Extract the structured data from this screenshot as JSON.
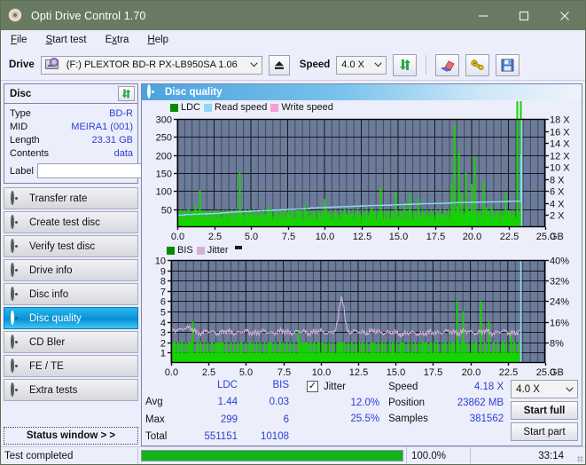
{
  "window": {
    "title": "Opti Drive Control 1.70",
    "app_icon": "disc-icon",
    "minimize": "–",
    "maximize": "□",
    "close": "✕"
  },
  "menu": {
    "items": [
      {
        "label": "File",
        "accel": "F"
      },
      {
        "label": "Start test",
        "accel": "S"
      },
      {
        "label": "Extra",
        "accel": "x"
      },
      {
        "label": "Help",
        "accel": "H"
      }
    ]
  },
  "toolbar": {
    "drive_label": "Drive",
    "drive_value": "(F:)  PLEXTOR BD-R  PX-LB950SA 1.06",
    "drive_icon": "drive-icon",
    "eject_icon": "eject-icon",
    "speed_label": "Speed",
    "speed_value": "4.0 X",
    "refresh_icon": "refresh-icon",
    "erase_icon": "eraser-icon",
    "tools_icon": "tools-icon",
    "save_icon": "save-icon"
  },
  "sidebar": {
    "disc_panel": {
      "title": "Disc",
      "refresh_icon": "refresh-icon",
      "rows": [
        {
          "key": "Type",
          "value": "BD-R"
        },
        {
          "key": "MID",
          "value": "MEIRA1 (001)"
        },
        {
          "key": "Length",
          "value": "23.31 GB"
        },
        {
          "key": "Contents",
          "value": "data"
        }
      ],
      "label_key": "Label",
      "label_value": "",
      "label_placeholder": "",
      "label_button_icon": "disc-icon"
    },
    "nav": [
      {
        "label": "Transfer rate",
        "icon": "disc-icon",
        "active": false
      },
      {
        "label": "Create test disc",
        "icon": "disc-icon",
        "active": false
      },
      {
        "label": "Verify test disc",
        "icon": "disc-icon",
        "active": false
      },
      {
        "label": "Drive info",
        "icon": "disc-icon",
        "active": false
      },
      {
        "label": "Disc info",
        "icon": "disc-icon",
        "active": false
      },
      {
        "label": "Disc quality",
        "icon": "disc-icon",
        "active": true
      },
      {
        "label": "CD Bler",
        "icon": "disc-icon",
        "active": false
      },
      {
        "label": "FE / TE",
        "icon": "disc-icon",
        "active": false
      },
      {
        "label": "Extra tests",
        "icon": "disc-icon",
        "active": false
      }
    ],
    "status_window_button": "Status window > >"
  },
  "main": {
    "header_title": "Disc quality",
    "header_icon": "disc-icon"
  },
  "stats": {
    "columns": [
      "LDC",
      "BIS"
    ],
    "rows": [
      {
        "key": "Avg",
        "ldc": "1.44",
        "bis": "0.03"
      },
      {
        "key": "Max",
        "ldc": "299",
        "bis": "6"
      },
      {
        "key": "Total",
        "ldc": "551151",
        "bis": "10108"
      }
    ],
    "jitter": {
      "label": "Jitter",
      "checked": true,
      "check_glyph": "✓",
      "avg": "12.0%",
      "max": "25.5%"
    },
    "speed": {
      "key": "Speed",
      "value": "4.18 X"
    },
    "position": {
      "key": "Position",
      "value": "23862 MB"
    },
    "samples": {
      "key": "Samples",
      "value": "381562"
    },
    "speed_select": "4.0 X",
    "start_full": "Start full",
    "start_part": "Start part"
  },
  "statusbar": {
    "message": "Test completed",
    "percent_label": "100.0%",
    "progress": 100,
    "time": "33:14"
  },
  "colors": {
    "titlebar": "#687a61",
    "plot_bg": "#6b7b99",
    "ldc_green": "#15d400",
    "bis_green": "#15d400",
    "read_speed": "#8fd8f5",
    "write_speed": "#f49fd8",
    "jitter_pink": "#d8aed8",
    "accent_blue": "#2b3fd0",
    "progress_green": "#13b31a",
    "active_nav": "#0a8fd4"
  },
  "chart_data": [
    {
      "type": "line",
      "id": "ldc-chart",
      "title": "",
      "legend": [
        {
          "name": "LDC",
          "color": "#0a8a00",
          "swatch": "#0a8a00"
        },
        {
          "name": "Read speed",
          "color": "#8fd8f5",
          "swatch": "#8fd8f5"
        },
        {
          "name": "Write speed",
          "color": "#f49fd8",
          "swatch": "#f49fd8"
        }
      ],
      "legend_position": "top-left",
      "grid": true,
      "xlabel": "GB",
      "ylabel": "",
      "xlim": [
        0.0,
        25.0
      ],
      "xticks": [
        "0.0",
        "2.5",
        "5.0",
        "7.5",
        "10.0",
        "12.5",
        "15.0",
        "17.5",
        "20.0",
        "22.5",
        "25.0"
      ],
      "ylim": [
        0,
        300
      ],
      "yticks": [
        "50",
        "100",
        "150",
        "200",
        "250",
        "300"
      ],
      "y2lim": [
        0,
        18
      ],
      "y2ticks": [
        "2 X",
        "4 X",
        "6 X",
        "8 X",
        "10 X",
        "12 X",
        "14 X",
        "16 X",
        "18 X"
      ],
      "series": [
        {
          "name": "LDC",
          "color": "#15d400",
          "render": "spikes",
          "x": [
            0.05,
            0.2,
            0.35,
            0.5,
            0.62,
            0.75,
            0.9,
            1.05,
            1.2,
            1.35,
            1.5,
            1.65,
            1.8,
            1.95,
            2.1,
            2.25,
            2.4,
            2.55,
            2.7,
            2.85,
            3.0,
            3.2,
            3.4,
            3.6,
            3.8,
            4.0,
            4.2,
            4.4,
            4.6,
            4.8,
            4.95,
            5.05,
            5.2,
            5.4,
            5.6,
            5.8,
            6.0,
            6.2,
            6.4,
            6.6,
            6.8,
            7.0,
            7.2,
            7.4,
            7.6,
            7.8,
            8.0,
            8.2,
            8.4,
            8.6,
            8.8,
            9.0,
            9.2,
            9.4,
            9.6,
            9.8,
            10.0,
            10.2,
            10.4,
            10.6,
            10.8,
            11.0,
            11.2,
            11.4,
            11.6,
            11.8,
            12.0,
            12.2,
            12.4,
            12.6,
            12.8,
            13.0,
            13.2,
            13.4,
            13.6,
            13.8,
            14.0,
            14.2,
            14.4,
            14.6,
            14.8,
            15.0,
            15.2,
            15.4,
            15.6,
            15.8,
            16.0,
            16.2,
            16.4,
            16.6,
            16.8,
            17.0,
            17.2,
            17.4,
            17.6,
            17.8,
            18.0,
            18.2,
            18.4,
            18.6,
            18.8,
            19.0,
            19.1,
            19.25,
            19.4,
            19.55,
            19.7,
            19.85,
            20.0,
            20.2,
            20.4,
            20.6,
            20.8,
            20.95,
            21.1,
            21.3,
            21.5,
            21.7,
            21.9,
            22.1,
            22.3,
            22.5,
            22.7,
            22.9,
            23.1,
            23.3
          ],
          "values": [
            30,
            20,
            45,
            18,
            22,
            50,
            16,
            24,
            60,
            20,
            102,
            30,
            20,
            40,
            18,
            22,
            30,
            20,
            26,
            18,
            22,
            30,
            20,
            26,
            18,
            22,
            152,
            30,
            20,
            26,
            42,
            18,
            22,
            30,
            20,
            26,
            18,
            58,
            22,
            30,
            20,
            26,
            18,
            22,
            30,
            20,
            26,
            44,
            18,
            62,
            22,
            30,
            20,
            26,
            18,
            22,
            78,
            30,
            20,
            26,
            18,
            22,
            30,
            48,
            20,
            26,
            18,
            22,
            30,
            20,
            26,
            18,
            55,
            22,
            30,
            112,
            20,
            26,
            18,
            22,
            96,
            30,
            20,
            68,
            26,
            92,
            18,
            22,
            80,
            30,
            20,
            26,
            18,
            22,
            30,
            20,
            26,
            18,
            22,
            120,
            283,
            60,
            210,
            95,
            35,
            150,
            58,
            42,
            120,
            195,
            45,
            30,
            126,
            55,
            40,
            60,
            30,
            40,
            35,
            30,
            95,
            45,
            30,
            25
          ]
        },
        {
          "name": "Read speed",
          "color": "#8fd8f5",
          "render": "step-line",
          "x": [
            0.0,
            0.5,
            1.0,
            1.5,
            2.0,
            2.5,
            3.0,
            3.5,
            4.0,
            4.5,
            5.0,
            5.5,
            6.0,
            6.5,
            7.0,
            7.5,
            8.0,
            8.5,
            9.0,
            9.5,
            10.0,
            10.5,
            11.0,
            11.5,
            12.0,
            12.5,
            13.0,
            13.5,
            14.0,
            14.5,
            15.0,
            15.5,
            16.0,
            16.5,
            17.0,
            17.5,
            18.0,
            18.5,
            19.0,
            19.5,
            20.0,
            20.5,
            21.0,
            21.5,
            22.0,
            22.5,
            23.0,
            23.3,
            23.35,
            23.4
          ],
          "values": [
            2.0,
            2.1,
            2.15,
            2.2,
            2.25,
            2.3,
            2.4,
            2.5,
            2.55,
            2.6,
            2.7,
            2.75,
            2.8,
            2.85,
            2.9,
            2.95,
            3.0,
            3.05,
            3.2,
            3.25,
            3.3,
            3.35,
            3.4,
            3.45,
            3.5,
            3.55,
            3.6,
            3.62,
            3.65,
            3.7,
            3.75,
            3.8,
            3.85,
            3.9,
            3.92,
            3.95,
            4.0,
            4.05,
            4.1,
            4.12,
            4.15,
            4.18,
            4.2,
            4.22,
            4.25,
            4.3,
            4.3,
            4.3,
            12.0,
            18.0
          ],
          "axis": "y2"
        },
        {
          "name": "Write speed",
          "color": "#f49fd8",
          "render": "none",
          "x": [],
          "values": []
        }
      ]
    },
    {
      "type": "line",
      "id": "bis-chart",
      "title": "",
      "legend": [
        {
          "name": "BIS",
          "color": "#0a8a00",
          "swatch": "#0a8a00"
        },
        {
          "name": "Jitter",
          "color": "#d8aed8",
          "swatch": "#d8aed8"
        }
      ],
      "legend_position": "top-left",
      "grid": true,
      "xlabel": "GB",
      "ylabel": "",
      "xlim": [
        0.0,
        25.0
      ],
      "xticks": [
        "0.0",
        "2.5",
        "5.0",
        "7.5",
        "10.0",
        "12.5",
        "15.0",
        "17.5",
        "20.0",
        "22.5",
        "25.0"
      ],
      "ylim": [
        0,
        10
      ],
      "yticks": [
        "1",
        "2",
        "3",
        "4",
        "5",
        "6",
        "7",
        "8",
        "9",
        "10"
      ],
      "y2lim": [
        0,
        40
      ],
      "y2ticks": [
        "8%",
        "16%",
        "24%",
        "32%",
        "40%"
      ],
      "series": [
        {
          "name": "BIS",
          "color": "#15d400",
          "render": "spikes-filled",
          "baseline": 1,
          "x": [
            0.1,
            0.25,
            0.45,
            0.7,
            0.95,
            1.2,
            1.45,
            1.7,
            1.95,
            2.2,
            2.45,
            2.7,
            2.95,
            3.2,
            3.45,
            3.7,
            3.95,
            4.2,
            4.45,
            4.7,
            4.95,
            5.2,
            5.45,
            5.7,
            5.95,
            6.2,
            6.45,
            6.7,
            6.95,
            7.2,
            7.45,
            7.7,
            7.95,
            8.2,
            8.45,
            8.7,
            8.95,
            9.05,
            9.3,
            9.55,
            9.8,
            10.05,
            10.3,
            10.55,
            10.8,
            11.05,
            11.3,
            11.55,
            11.8,
            12.05,
            12.3,
            12.55,
            12.8,
            13.05,
            13.3,
            13.55,
            13.8,
            14.05,
            14.3,
            14.55,
            14.8,
            15.05,
            15.3,
            15.55,
            15.8,
            16.05,
            16.3,
            16.55,
            16.8,
            17.05,
            17.3,
            17.55,
            17.8,
            18.05,
            18.3,
            18.55,
            18.8,
            19.05,
            19.2,
            19.5,
            19.8,
            20.1,
            20.4,
            20.7,
            20.95,
            21.2,
            21.5,
            21.8,
            22.1,
            22.4,
            22.7,
            22.95,
            23.2
          ],
          "values": [
            2,
            2,
            2,
            2,
            2,
            2,
            4,
            2,
            2,
            2,
            2,
            2,
            2,
            2,
            2,
            2,
            2,
            2,
            2,
            2,
            2,
            2,
            2,
            2,
            2,
            2,
            2,
            2,
            2,
            2,
            2,
            2,
            2,
            2,
            3,
            2,
            2,
            2,
            2,
            2,
            2,
            2,
            2,
            2,
            2,
            2,
            2,
            2,
            2,
            2,
            2,
            2,
            2,
            2,
            2,
            2,
            2,
            2,
            2,
            2,
            2,
            2,
            2,
            2,
            2,
            2,
            2,
            2,
            2,
            2,
            2,
            2,
            2,
            2,
            2,
            2,
            2,
            6,
            2,
            5,
            2,
            2,
            2,
            6,
            2,
            4,
            2,
            2,
            2,
            2,
            3,
            2,
            2
          ]
        },
        {
          "name": "Jitter",
          "color": "#d8aed8",
          "render": "noisy-line",
          "axis": "y2",
          "mean_percent": 12.0,
          "max_percent": 25.5,
          "peak_x": 11.4,
          "peak_percent": 25.5
        }
      ]
    }
  ]
}
